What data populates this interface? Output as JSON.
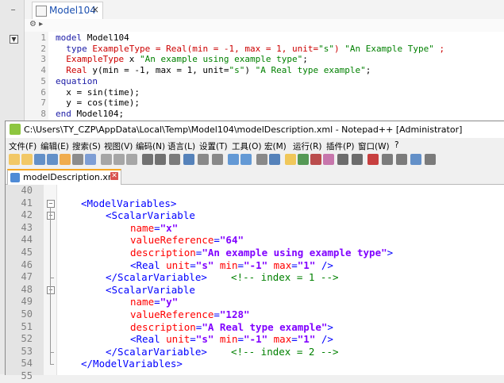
{
  "left_strip": {
    "minus": "−",
    "dropdown": "▼"
  },
  "omedit": {
    "tab_title": "Model104",
    "tab_close": "×",
    "breadcrumb": "⚙  ▸",
    "lines": [
      {
        "num": "1",
        "parts": [
          {
            "t": "model ",
            "c": "kw"
          },
          {
            "t": "Model104",
            "c": "nm"
          }
        ]
      },
      {
        "num": "2",
        "parts": [
          {
            "t": "  type ",
            "c": "kw"
          },
          {
            "t": "ExampleType = Real",
            "c": "ty"
          },
          {
            "t": "(min = -1, max = 1, unit=",
            "c": "ty"
          },
          {
            "t": "\"s\"",
            "c": "str"
          },
          {
            "t": ") ",
            "c": "ty"
          },
          {
            "t": "\"An Example Type\"",
            "c": "str"
          },
          {
            "t": " ;",
            "c": "ty"
          }
        ]
      },
      {
        "num": "3",
        "parts": [
          {
            "t": "  ExampleType ",
            "c": "ty"
          },
          {
            "t": "x ",
            "c": "nm"
          },
          {
            "t": "\"An example using example type\"",
            "c": "str"
          },
          {
            "t": ";",
            "c": "nm"
          }
        ]
      },
      {
        "num": "4",
        "parts": [
          {
            "t": "  Real ",
            "c": "ty"
          },
          {
            "t": "y(min = -1, max = 1, unit=",
            "c": "nm"
          },
          {
            "t": "\"s\"",
            "c": "str"
          },
          {
            "t": ") ",
            "c": "nm"
          },
          {
            "t": "\"A Real type example\"",
            "c": "str"
          },
          {
            "t": ";",
            "c": "nm"
          }
        ]
      },
      {
        "num": "5",
        "parts": [
          {
            "t": "equation",
            "c": "kw"
          }
        ]
      },
      {
        "num": "6",
        "parts": [
          {
            "t": "  x = sin(time);",
            "c": "nm"
          }
        ]
      },
      {
        "num": "7",
        "parts": [
          {
            "t": "  y = cos(time);",
            "c": "nm"
          }
        ]
      },
      {
        "num": "8",
        "parts": [
          {
            "t": "end ",
            "c": "kw"
          },
          {
            "t": "Model104;",
            "c": "nm"
          }
        ]
      }
    ]
  },
  "npp": {
    "title": "C:\\Users\\TY_CZP\\AppData\\Local\\Temp\\Model104\\modelDescription.xml - Notepad++ [Administrator]",
    "menu": [
      "文件(F)",
      "编辑(E)",
      "搜索(S)",
      "视图(V)",
      "编码(N)",
      "语言(L)",
      "设置(T)",
      "工具(O)",
      "宏(M)",
      "运行(R)",
      "插件(P)",
      "窗口(W)",
      "?"
    ],
    "tab_label": "modelDescription.xml",
    "tab_close": "✕",
    "lines": [
      {
        "num": "40",
        "fold": "",
        "parts": []
      },
      {
        "num": "41",
        "fold": "minus",
        "parts": [
          {
            "t": "<ModelVariables>",
            "c": "tag"
          }
        ],
        "indent": 1
      },
      {
        "num": "42",
        "fold": "minus",
        "parts": [
          {
            "t": "<ScalarVariable",
            "c": "tag"
          }
        ],
        "indent": 2
      },
      {
        "num": "43",
        "fold": "",
        "parts": [
          {
            "t": "name",
            "c": "attr"
          },
          {
            "t": "=",
            "c": "tag"
          },
          {
            "t": "\"x\"",
            "c": "val"
          }
        ],
        "indent": 3
      },
      {
        "num": "44",
        "fold": "",
        "parts": [
          {
            "t": "valueReference",
            "c": "attr"
          },
          {
            "t": "=",
            "c": "tag"
          },
          {
            "t": "\"64\"",
            "c": "val"
          }
        ],
        "indent": 3
      },
      {
        "num": "45",
        "fold": "",
        "parts": [
          {
            "t": "description",
            "c": "attr"
          },
          {
            "t": "=",
            "c": "tag"
          },
          {
            "t": "\"An example using example type\"",
            "c": "val"
          },
          {
            "t": ">",
            "c": "tag"
          }
        ],
        "indent": 3
      },
      {
        "num": "46",
        "fold": "",
        "parts": [
          {
            "t": "<Real ",
            "c": "tag"
          },
          {
            "t": "unit",
            "c": "attr"
          },
          {
            "t": "=",
            "c": "tag"
          },
          {
            "t": "\"s\"",
            "c": "val"
          },
          {
            "t": " min",
            "c": "attr"
          },
          {
            "t": "=",
            "c": "tag"
          },
          {
            "t": "\"-1\"",
            "c": "val"
          },
          {
            "t": " max",
            "c": "attr"
          },
          {
            "t": "=",
            "c": "tag"
          },
          {
            "t": "\"1\"",
            "c": "val"
          },
          {
            "t": " />",
            "c": "tag"
          }
        ],
        "indent": 3
      },
      {
        "num": "47",
        "fold": "end",
        "parts": [
          {
            "t": "</ScalarVariable>",
            "c": "tag"
          },
          {
            "t": "    <!-- index = 1 -->",
            "c": "cmt"
          }
        ],
        "indent": 2
      },
      {
        "num": "48",
        "fold": "minus",
        "parts": [
          {
            "t": "<ScalarVariable",
            "c": "tag"
          }
        ],
        "indent": 2
      },
      {
        "num": "49",
        "fold": "",
        "parts": [
          {
            "t": "name",
            "c": "attr"
          },
          {
            "t": "=",
            "c": "tag"
          },
          {
            "t": "\"y\"",
            "c": "val"
          }
        ],
        "indent": 3
      },
      {
        "num": "50",
        "fold": "",
        "parts": [
          {
            "t": "valueReference",
            "c": "attr"
          },
          {
            "t": "=",
            "c": "tag"
          },
          {
            "t": "\"128\"",
            "c": "val"
          }
        ],
        "indent": 3
      },
      {
        "num": "51",
        "fold": "",
        "parts": [
          {
            "t": "description",
            "c": "attr"
          },
          {
            "t": "=",
            "c": "tag"
          },
          {
            "t": "\"A Real type example\"",
            "c": "val"
          },
          {
            "t": ">",
            "c": "tag"
          }
        ],
        "indent": 3
      },
      {
        "num": "52",
        "fold": "",
        "parts": [
          {
            "t": "<Real ",
            "c": "tag"
          },
          {
            "t": "unit",
            "c": "attr"
          },
          {
            "t": "=",
            "c": "tag"
          },
          {
            "t": "\"s\"",
            "c": "val"
          },
          {
            "t": " min",
            "c": "attr"
          },
          {
            "t": "=",
            "c": "tag"
          },
          {
            "t": "\"-1\"",
            "c": "val"
          },
          {
            "t": " max",
            "c": "attr"
          },
          {
            "t": "=",
            "c": "tag"
          },
          {
            "t": "\"1\"",
            "c": "val"
          },
          {
            "t": " />",
            "c": "tag"
          }
        ],
        "indent": 3
      },
      {
        "num": "53",
        "fold": "end",
        "parts": [
          {
            "t": "</ScalarVariable>",
            "c": "tag"
          },
          {
            "t": "    <!-- index = 2 -->",
            "c": "cmt"
          }
        ],
        "indent": 2
      },
      {
        "num": "54",
        "fold": "end",
        "parts": [
          {
            "t": "</ModelVariables>",
            "c": "tag"
          }
        ],
        "indent": 1
      },
      {
        "num": "55",
        "fold": "",
        "parts": []
      }
    ]
  }
}
